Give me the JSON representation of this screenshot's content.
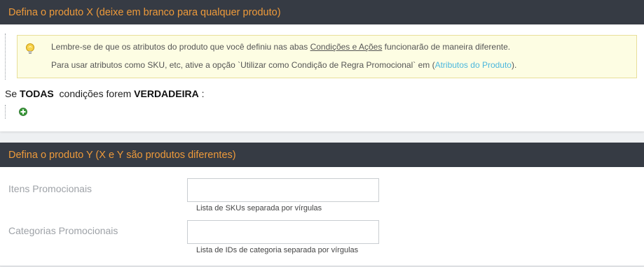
{
  "section_x": {
    "title": "Defina o produto X (deixe em branco para qualquer produto)",
    "notice": {
      "line1_prefix": "Lembre-se de que os atributos do produto que você definiu nas abas ",
      "line1_link": "Condições e Ações",
      "line1_suffix": " funcionarão de maneira diferente.",
      "line2_prefix": "Para usar atributos como SKU, etc, ative a opção `Utilizar como Condição de Regra Promocional` em (",
      "line2_link": "Atributos do Produto",
      "line2_suffix": ")."
    },
    "rule": {
      "prefix": "Se ",
      "aggregator": "TODAS",
      "middle": "  condições forem ",
      "value": "VERDADEIRA",
      "suffix": " :"
    }
  },
  "section_y": {
    "title": "Defina o produto Y (X e Y são produtos diferentes)",
    "fields": [
      {
        "label": "Itens Promocionais",
        "value": "",
        "hint": "Lista de SKUs separada por vírgulas"
      },
      {
        "label": "Categorias Promocionais",
        "value": "",
        "hint": "Lista de IDs de categoria separada por vírgulas"
      }
    ]
  },
  "colors": {
    "header_bg": "#363b44",
    "header_text": "#ee9a3a",
    "notice_bg": "#fdfde3",
    "link": "#4bb7dd",
    "add_icon": "#3a9a3a"
  },
  "icons": [
    "lightbulb-icon",
    "add-condition-icon"
  ]
}
